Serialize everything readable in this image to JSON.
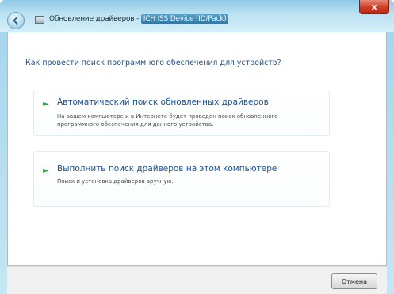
{
  "window": {
    "title_prefix": "Обновление драйверов - ",
    "title_device": "ICH ISS Device (ID/Pack)",
    "close_label": "x"
  },
  "main": {
    "heading": "Как провести поиск программного обеспечения для устройств?",
    "options": [
      {
        "title": "Автоматический поиск обновленных драйверов",
        "description": "На вашем компьютере и в Интернете будет проведен поиск обновленного программного обеспечения для данного устройства."
      },
      {
        "title": "Выполнить поиск драйверов на этом компьютере",
        "description": "Поиск и установка драйверов вручную."
      }
    ]
  },
  "footer": {
    "cancel_label": "Отмена"
  },
  "icons": {
    "back": "back-arrow-icon",
    "device": "device-icon",
    "option_bullet": "green-arrow-icon"
  },
  "colors": {
    "accent_text": "#1f4e8c",
    "bullet": "#2ea043",
    "close_button": "#cf3a22"
  }
}
